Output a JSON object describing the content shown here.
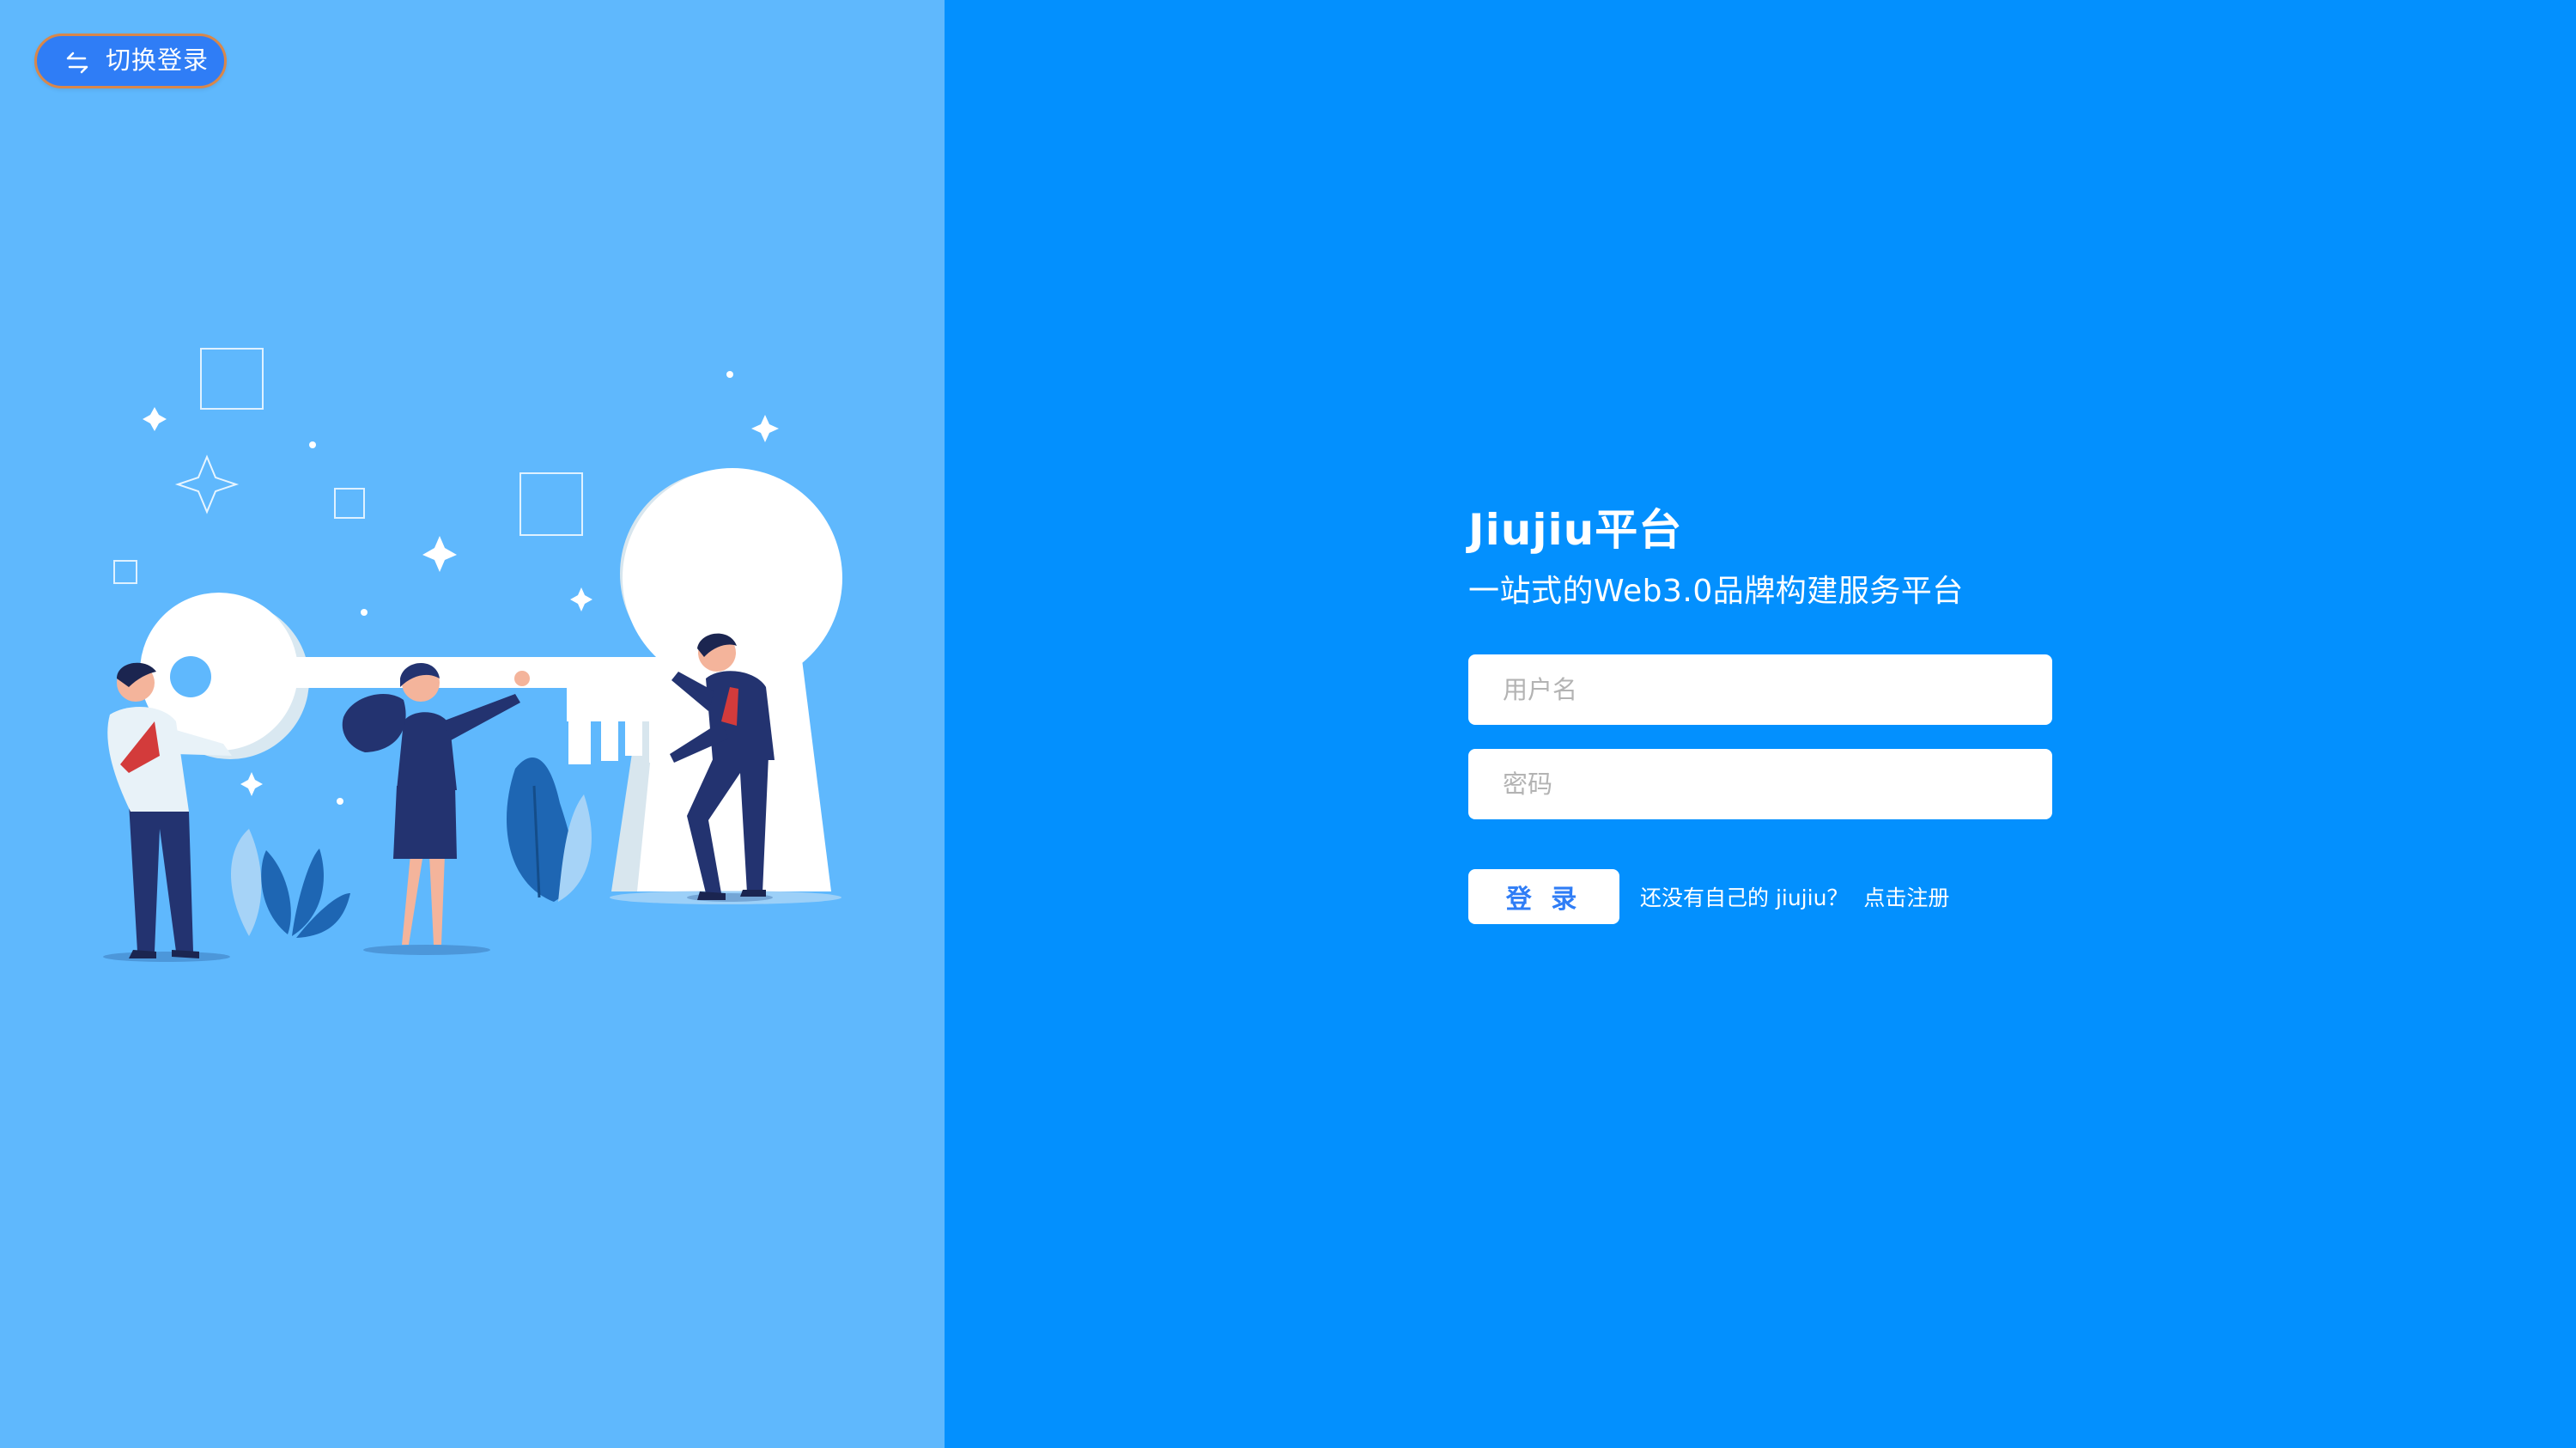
{
  "switch_button": {
    "label": "切换登录",
    "icon": "swap-arrows-icon"
  },
  "brand": {
    "title": "Jiujiu平台",
    "subtitle": "一站式的Web3.0品牌构建服务平台"
  },
  "form": {
    "username_placeholder": "用户名",
    "username_value": "",
    "password_placeholder": "密码",
    "password_value": "",
    "login_label": "登 录",
    "register_hint": "还没有自己的 jiujiu？",
    "register_link": "点击注册"
  },
  "colors": {
    "left_panel": "#5fb8fd",
    "right_panel": "#0390fe",
    "accent": "#2f7df6",
    "navy": "#233370"
  }
}
